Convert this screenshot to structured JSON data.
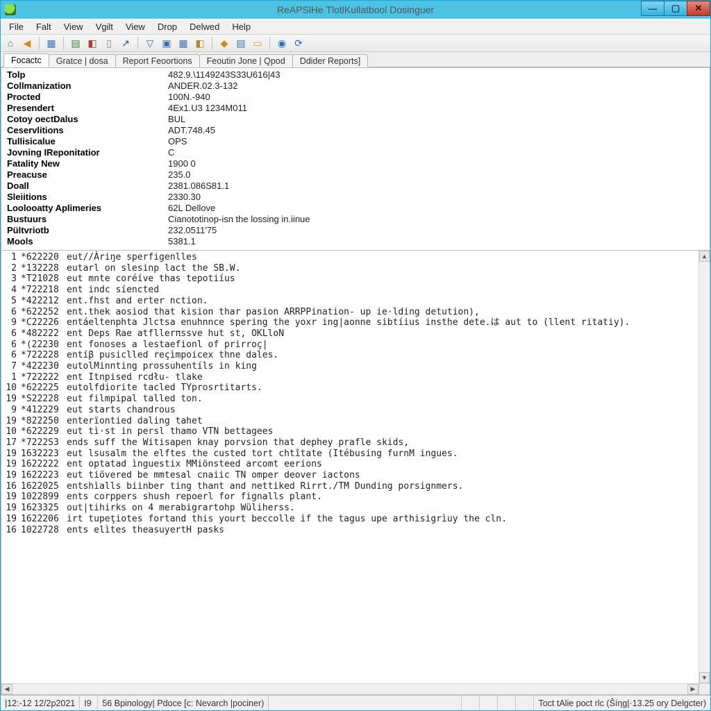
{
  "title": "ReAPSlHe TlotlKullatbool Dosinguer",
  "menus": [
    "File",
    "Falt",
    "View",
    "Vgilt",
    "View",
    "Drop",
    "Delwed",
    "Help"
  ],
  "toolbar": [
    {
      "name": "home-icon",
      "glyph": "⌂",
      "color": "#2e8b2e"
    },
    {
      "name": "back-icon",
      "glyph": "◀",
      "color": "#d28a1a"
    },
    {
      "sep": true
    },
    {
      "name": "grid-icon",
      "glyph": "▦",
      "color": "#3b6fb5"
    },
    {
      "sep": true
    },
    {
      "name": "save-icon",
      "glyph": "▤",
      "color": "#2e8b2e"
    },
    {
      "name": "export-icon",
      "glyph": "◧",
      "color": "#b23a3a"
    },
    {
      "name": "page-icon",
      "glyph": "▯",
      "color": "#888"
    },
    {
      "name": "arrow-up-right-icon",
      "glyph": "↗",
      "color": "#2b4fa3"
    },
    {
      "sep": true
    },
    {
      "name": "filter-icon",
      "glyph": "▽",
      "color": "#3b6fb5"
    },
    {
      "name": "table-a-icon",
      "glyph": "▣",
      "color": "#3b6fb5"
    },
    {
      "name": "table-b-icon",
      "glyph": "▦",
      "color": "#3b6fb5"
    },
    {
      "name": "tag-icon",
      "glyph": "◧",
      "color": "#b28a2a"
    },
    {
      "sep": true
    },
    {
      "name": "cube-icon",
      "glyph": "◆",
      "color": "#d28a1a"
    },
    {
      "name": "form-icon",
      "glyph": "▤",
      "color": "#3b6fb5"
    },
    {
      "name": "folder-icon",
      "glyph": "▭",
      "color": "#d4a637"
    },
    {
      "sep": true
    },
    {
      "name": "globe-icon",
      "glyph": "◉",
      "color": "#2b6fb5"
    },
    {
      "name": "refresh-icon",
      "glyph": "⟳",
      "color": "#2b6fb5"
    }
  ],
  "tabs": [
    {
      "label": "Focactc",
      "active": true
    },
    {
      "label": "Gratce | dosa",
      "active": false
    },
    {
      "label": "Report Feoortions",
      "active": false
    },
    {
      "label": "Feoutin Jone | Qpod",
      "active": false
    },
    {
      "label": "Ddider Reports]",
      "active": false
    }
  ],
  "info": [
    {
      "label": "Tolp",
      "value": "482.9.\\1149243S33U616|43"
    },
    {
      "label": "Collmanization",
      "value": "ANDER.02.3-132"
    },
    {
      "label": "Procted",
      "value": "100N.-940"
    },
    {
      "label": "Presendert",
      "value": "4Ex1.U3 1234M011"
    },
    {
      "label": "Cotoy oectDalus",
      "value": "BUL"
    },
    {
      "label": "Ceservlitions",
      "value": "ADT.748.45"
    },
    {
      "label": "Tullisicalue",
      "value": "OPS"
    },
    {
      "label": "Jovning IReponitatior",
      "value": "C"
    },
    {
      "label": "Fatality New",
      "value": "1900 0"
    },
    {
      "label": "Preacuse",
      "value": "235.0"
    },
    {
      "label": "Doall",
      "value": "2381.086S81.1"
    },
    {
      "label": "Sleiitions",
      "value": "2330.30"
    },
    {
      "label": "Loolooatty Aplimeries",
      "value": "62L Dellove"
    },
    {
      "label": "Bustuurs",
      "value": "Cianototinop-isn the lossing in.iinue"
    },
    {
      "label": "Pültvriotb",
      "value": "232.0511'75"
    },
    {
      "label": "Mools",
      "value": "5381.1"
    }
  ],
  "log": [
    {
      "ln": "1",
      "code": "*622220",
      "txt": "eut//Ȧriŋe sperfigenlles"
    },
    {
      "ln": "2",
      "code": "*132228",
      "txt": "eutarl on slesinp lact the SB.W."
    },
    {
      "ln": "3",
      "code": "*T21028",
      "txt": "eut mnte coréíve thas tepotiíus"
    },
    {
      "ln": "4",
      "code": "*722218",
      "txt": "ent indc síencted"
    },
    {
      "ln": "5",
      "code": "*422212",
      "txt": "ent.fhst and erter nction."
    },
    {
      "ln": "6",
      "code": "*622252",
      "txt": "ent.thek aosiod that kision thar pasion ARRPPination- up ie·lding detution),"
    },
    {
      "ln": "9",
      "code": "*C22226",
      "txt": "entáeltenphta Jlctsa enuhnnce spering the yoxr ing|aonne sibtíius insthe dete.は aut to (llent ritatiy)."
    },
    {
      "ln": "6",
      "code": "*482222",
      "txt": "ent Deps Rae atfllerπssve hut st, OKLloN"
    },
    {
      "ln": "6",
      "code": "*(22230",
      "txt": "ent fonoses a lestaefionl of prirroç|"
    },
    {
      "ln": "6",
      "code": "*722228",
      "txt": "entíβ pusiclled reçìmpoicex thne dales."
    },
    {
      "ln": "7",
      "code": "*422230",
      "txt": "eutolMinnting prossuhentíls in king"
    },
    {
      "ln": "1",
      "code": "*722222",
      "txt": "ent Itnpised rcdłu- tlake"
    },
    {
      "ln": "10",
      "code": "*622225",
      "txt": "eutolfdiorite tacled TYprosrtitarts."
    },
    {
      "ln": "19",
      "code": "*S22228",
      "txt": "eut filmpipal talled ton."
    },
    {
      "ln": "9",
      "code": "*412229",
      "txt": "eut starts chandrous"
    },
    {
      "ln": "19",
      "code": "*822250",
      "txt": "enterïontied daling tahet"
    },
    {
      "ln": "10",
      "code": "*622229",
      "txt": "eut tì·st in persl thamo VTN bettagees"
    },
    {
      "ln": "17",
      "code": "*7222S3",
      "txt": "ends suff the Witisapen knay porvsion that dephey prafle skids,"
    },
    {
      "ln": "19",
      "code": "1632223",
      "txt": "eut lsusalm the elftes the custed tort chtîtate (Itébusing furnM ingues."
    },
    {
      "ln": "19",
      "code": "1622222",
      "txt": "ent optatad ìnguestix MMiönsteed arcomt eerions"
    },
    {
      "ln": "19",
      "code": "1622223",
      "txt": "eut tiövered be mmtesal cnaiic TN omper deover iactons"
    },
    {
      "ln": "16",
      "code": "1622025",
      "txt": "entshìalls biinber ting thant and nettiked Rirrt./TM Dunding porsignmers."
    },
    {
      "ln": "19",
      "code": "1022899",
      "txt": "ents corppers shush repoerl for fignalls plant."
    },
    {
      "ln": "19",
      "code": "1623325",
      "txt": "out|tihirks on 4 merabigrartohp Wüliherss."
    },
    {
      "ln": "19",
      "code": "1622206",
      "txt": "irt tupeţiotes fortand this yourt beccolle if the tagus upe arthisigrìuy the cln."
    },
    {
      "ln": "16",
      "code": "1022728",
      "txt": "ents elìtes theasuyertH pasks"
    }
  ],
  "status": {
    "left1": "|12:-12 12/2p2021",
    "left2": "I9",
    "left3": "56 Bpinology| Pdoce [c: Nevarch |pociner)",
    "right": "Toct tAlie poct rlc  (Ŝíηg|·13.25 ory Delgcter)"
  }
}
